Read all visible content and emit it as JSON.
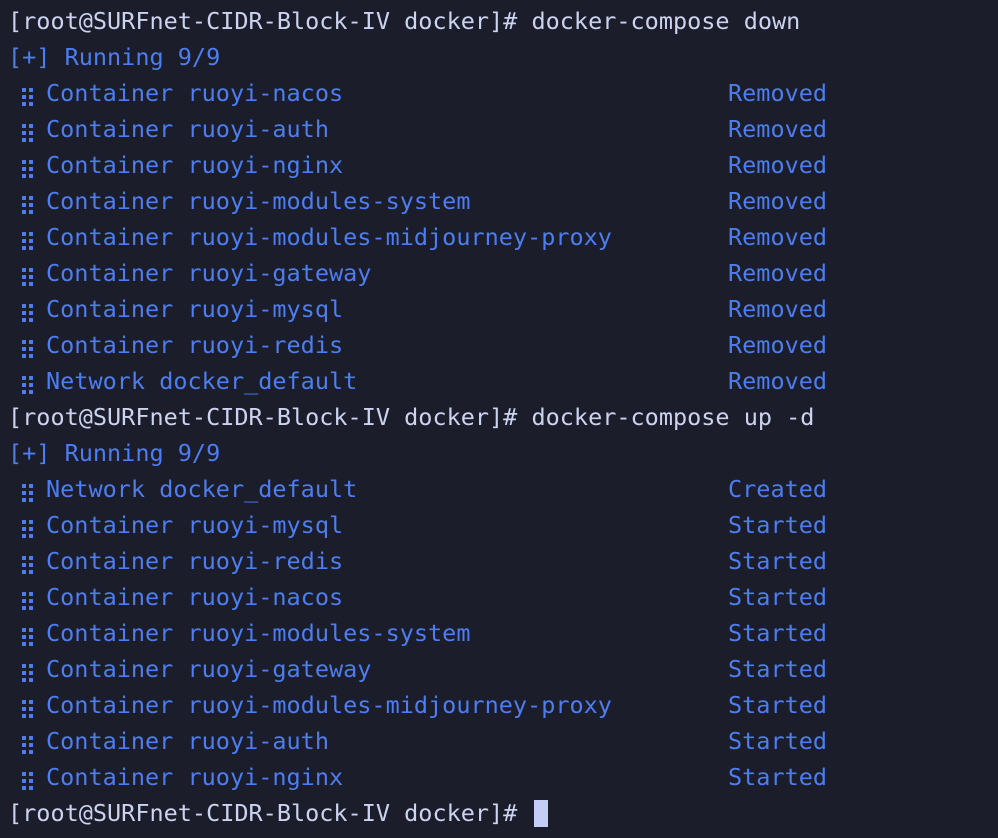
{
  "terminal": {
    "background_color": "#1b1d2a",
    "prompt_color": "#ccd3f0",
    "output_color": "#4d7df0",
    "cursor_color": "#c3cdf5",
    "prompt_string": "[root@SURFnet-CIDR-Block-IV docker]# ",
    "bullet_icon": "drag-handle-dots-icon",
    "lines": [
      {
        "type": "prompt",
        "ps1": "[root@SURFnet-CIDR-Block-IV docker]# ",
        "cmd": "docker-compose down"
      },
      {
        "type": "running",
        "text": "[+] Running 9/9"
      },
      {
        "type": "resource",
        "kind": "Container",
        "name": "ruoyi-nacos",
        "status": "Removed"
      },
      {
        "type": "resource",
        "kind": "Container",
        "name": "ruoyi-auth",
        "status": "Removed"
      },
      {
        "type": "resource",
        "kind": "Container",
        "name": "ruoyi-nginx",
        "status": "Removed"
      },
      {
        "type": "resource",
        "kind": "Container",
        "name": "ruoyi-modules-system",
        "status": "Removed"
      },
      {
        "type": "resource",
        "kind": "Container",
        "name": "ruoyi-modules-midjourney-proxy",
        "status": "Removed"
      },
      {
        "type": "resource",
        "kind": "Container",
        "name": "ruoyi-gateway",
        "status": "Removed"
      },
      {
        "type": "resource",
        "kind": "Container",
        "name": "ruoyi-mysql",
        "status": "Removed"
      },
      {
        "type": "resource",
        "kind": "Container",
        "name": "ruoyi-redis",
        "status": "Removed"
      },
      {
        "type": "resource",
        "kind": "Network",
        "name": "docker_default",
        "status": "Removed"
      },
      {
        "type": "prompt",
        "ps1": "[root@SURFnet-CIDR-Block-IV docker]# ",
        "cmd": "docker-compose up -d"
      },
      {
        "type": "running",
        "text": "[+] Running 9/9"
      },
      {
        "type": "resource",
        "kind": "Network",
        "name": "docker_default",
        "status": "Created"
      },
      {
        "type": "resource",
        "kind": "Container",
        "name": "ruoyi-mysql",
        "status": "Started"
      },
      {
        "type": "resource",
        "kind": "Container",
        "name": "ruoyi-redis",
        "status": "Started"
      },
      {
        "type": "resource",
        "kind": "Container",
        "name": "ruoyi-nacos",
        "status": "Started"
      },
      {
        "type": "resource",
        "kind": "Container",
        "name": "ruoyi-modules-system",
        "status": "Started"
      },
      {
        "type": "resource",
        "kind": "Container",
        "name": "ruoyi-gateway",
        "status": "Started"
      },
      {
        "type": "resource",
        "kind": "Container",
        "name": "ruoyi-modules-midjourney-proxy",
        "status": "Started"
      },
      {
        "type": "resource",
        "kind": "Container",
        "name": "ruoyi-auth",
        "status": "Started"
      },
      {
        "type": "resource",
        "kind": "Container",
        "name": "ruoyi-nginx",
        "status": "Started"
      },
      {
        "type": "prompt-cursor",
        "ps1": "[root@SURFnet-CIDR-Block-IV docker]# ",
        "cmd": ""
      }
    ]
  }
}
